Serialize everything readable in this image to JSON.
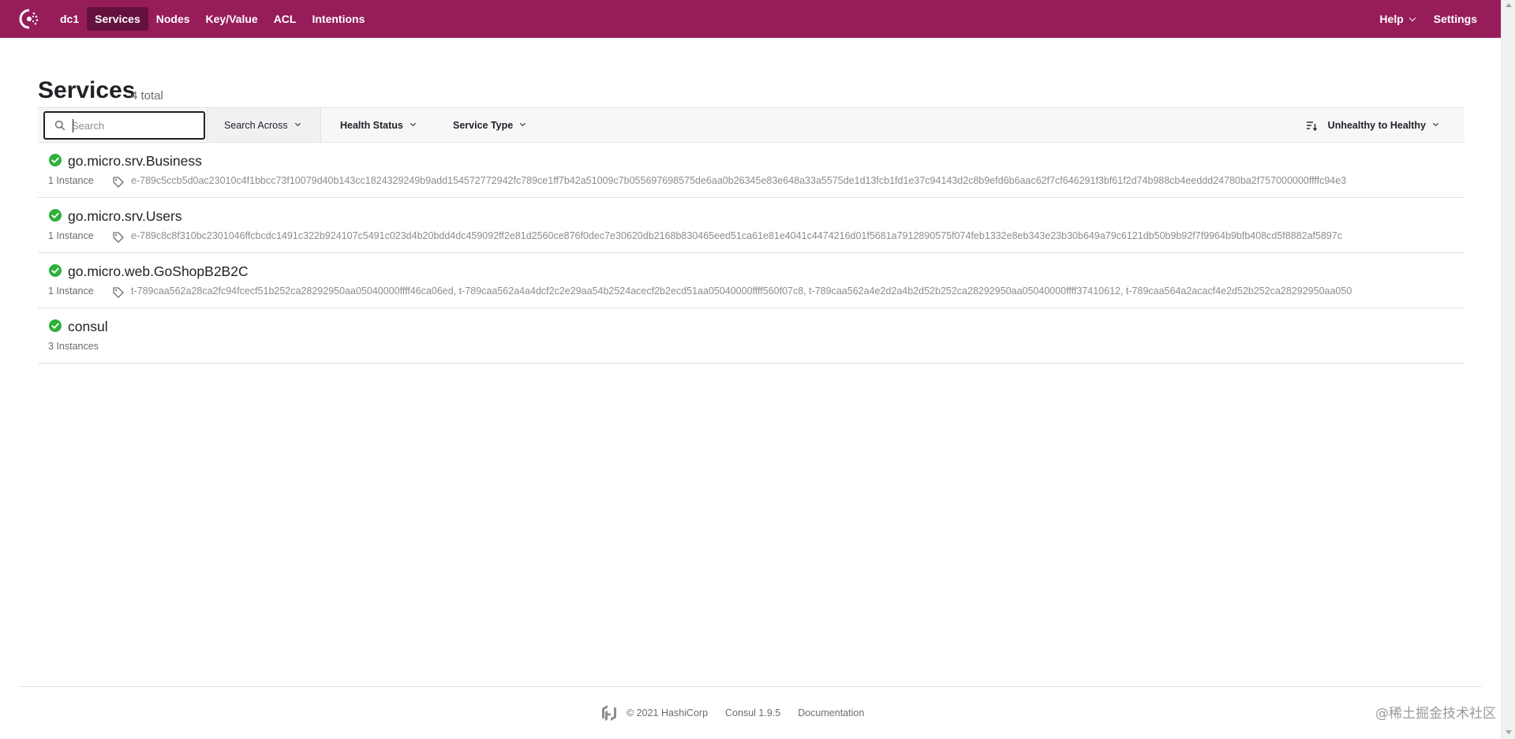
{
  "nav": {
    "datacenter": "dc1",
    "items": [
      {
        "label": "Services",
        "active": true
      },
      {
        "label": "Nodes"
      },
      {
        "label": "Key/Value"
      },
      {
        "label": "ACL"
      },
      {
        "label": "Intentions"
      }
    ],
    "help_label": "Help",
    "settings_label": "Settings",
    "brand_color": "#961d59",
    "active_color": "#64113d"
  },
  "page": {
    "title": "Services",
    "count": "4 total"
  },
  "filters": {
    "search_placeholder": "Search",
    "search_value": "",
    "search_across_label": "Search Across",
    "health_status_label": "Health Status",
    "service_type_label": "Service Type",
    "sort_label": "Unhealthy to Healthy"
  },
  "services": [
    {
      "name": "go.micro.srv.Business",
      "instances": "1 Instance",
      "status": "passing",
      "tags": "e-789c5ccb5d0ac23010c4f1bbcc73f10079d40b143cc1824329249b9add154572772942fc789ce1ff7b42a51009c7b055697698575de6aa0b26345e83e648a33a5575de1d13fcb1fd1e37c94143d2c8b9efd6b6aac62f7cf646291f3bf61f2d74b988cb4eeddd24780ba2f757000000ffffc94e3"
    },
    {
      "name": "go.micro.srv.Users",
      "instances": "1 Instance",
      "status": "passing",
      "tags": "e-789c8c8f310bc2301046ffcbcdc1491c322b924107c5491c023d4b20bdd4dc459092ff2e81d2560ce876f0dec7e30620db2168b830465eed51ca61e81e4041c4474216d01f5681a7912890575f074feb1332e8eb343e23b30b649a79c6121db50b9b92f7f9964b9bfb408cd5f8882af5897c"
    },
    {
      "name": "go.micro.web.GoShopB2B2C",
      "instances": "1 Instance",
      "status": "passing",
      "tags": "t-789caa562a28ca2fc94fcecf51b252ca28292950aa05040000ffff46ca06ed, t-789caa562a4a4dcf2c2e29aa54b2524acecf2b2ecd51aa05040000ffff560f07c8, t-789caa562a4e2d2a4b2d52b252ca28292950aa05040000ffff37410612, t-789caa564a2acacf4e2d52b252ca28292950aa050"
    },
    {
      "name": "consul",
      "instances": "3 Instances",
      "status": "passing",
      "tags": ""
    }
  ],
  "footer": {
    "copyright": "© 2021 HashiCorp",
    "version": "Consul 1.9.5",
    "docs_label": "Documentation"
  },
  "watermark": "@稀土掘金技术社区"
}
